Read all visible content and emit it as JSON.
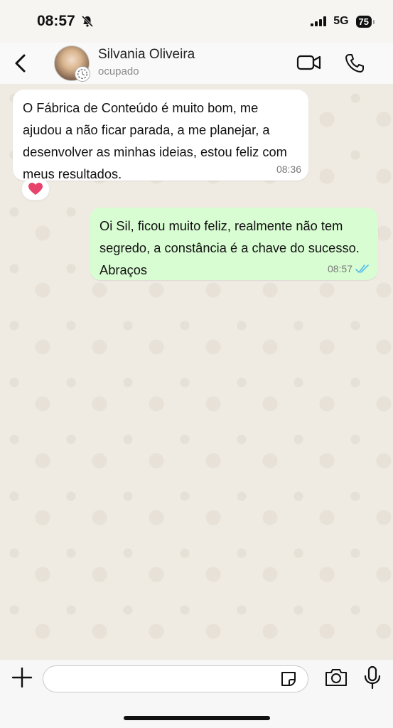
{
  "status_bar": {
    "time": "08:57",
    "network": "5G",
    "battery": "75",
    "icons": [
      "silent-bell-icon",
      "signal-icon",
      "battery-icon"
    ]
  },
  "header": {
    "contact_name": "Silvania Oliveira",
    "contact_status": "ocupado",
    "icons": [
      "back-chevron-icon",
      "video-call-icon",
      "phone-icon"
    ]
  },
  "messages": [
    {
      "direction": "incoming",
      "text": "O Fábrica de Conteúdo é muito bom, me ajudou a não ficar parada, a me planejar, a desenvolver as minhas ideias, estou feliz com meus resultados.",
      "time": "08:36",
      "reaction": "heart"
    },
    {
      "direction": "outgoing",
      "text": "Oi Sil, ficou muito feliz, realmente não tem segredo, a constância é a chave do sucesso. Abraços",
      "time": "08:57",
      "status": "read"
    }
  ],
  "input_bar": {
    "placeholder": "",
    "icons": [
      "plus-icon",
      "sticker-icon",
      "camera-icon",
      "microphone-icon"
    ]
  },
  "colors": {
    "incoming_bubble": "#ffffff",
    "outgoing_bubble": "#d9fdd3",
    "chat_background": "#efeae2",
    "read_ticks": "#53bdeb",
    "reaction_heart": "#e8446b"
  }
}
